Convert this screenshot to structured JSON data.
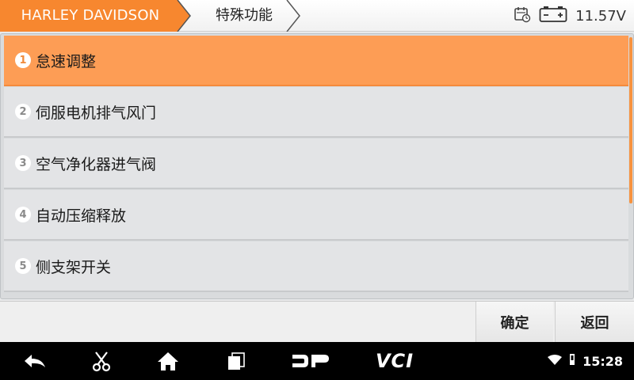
{
  "header": {
    "brand": "HARLEY DAVIDSON",
    "section": "特殊功能",
    "voltage": "11.57V",
    "icons": [
      "calendar-clock-icon",
      "battery-icon"
    ]
  },
  "menu": {
    "items": [
      {
        "num": "1",
        "label": "怠速调整",
        "selected": true
      },
      {
        "num": "2",
        "label": "伺服电机排气风门"
      },
      {
        "num": "3",
        "label": "空气净化器进气阀"
      },
      {
        "num": "4",
        "label": "自动压缩释放"
      },
      {
        "num": "5",
        "label": "侧支架开关"
      }
    ]
  },
  "toolbar": {
    "confirm": "确定",
    "back": "返回"
  },
  "navbar": {
    "dp": "DP",
    "vci": "VCI",
    "time": "15:28",
    "icons": [
      "back-icon",
      "scissors-icon",
      "home-icon",
      "recent-apps-icon",
      "wifi-icon",
      "sim-icon"
    ]
  },
  "colors": {
    "accent": "#fd9d55",
    "brand_tab": "#f7872f"
  }
}
